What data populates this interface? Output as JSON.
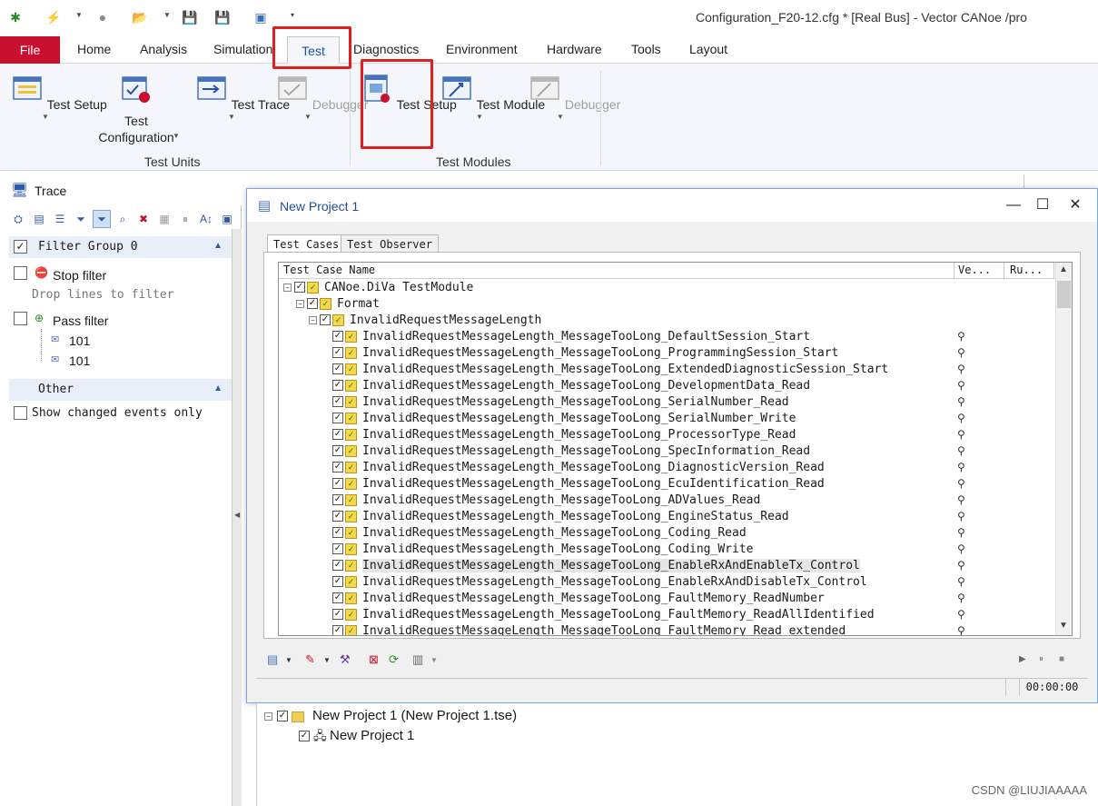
{
  "app": {
    "title": "Configuration_F20-12.cfg * [Real Bus] - Vector CANoe /pro",
    "watermark": "CSDN @LIUJIAAAAA"
  },
  "ribbon": {
    "tabs": [
      "File",
      "Home",
      "Analysis",
      "Simulation",
      "Test",
      "Diagnostics",
      "Environment",
      "Hardware",
      "Tools",
      "Layout"
    ],
    "active_tab": "Test",
    "groups": [
      {
        "label": "Test Units",
        "buttons": [
          {
            "label": "Test Setup",
            "enabled": true
          },
          {
            "label": "Test\nConfiguration",
            "enabled": true
          },
          {
            "label": "Test Trace",
            "enabled": true
          },
          {
            "label": "Debugger",
            "enabled": false
          }
        ]
      },
      {
        "label": "Test Modules",
        "buttons": [
          {
            "label": "Test Setup",
            "enabled": true
          },
          {
            "label": "Test Module",
            "enabled": true
          },
          {
            "label": "Debugger",
            "enabled": false
          }
        ]
      }
    ]
  },
  "trace": {
    "title": "Trace",
    "filter_group": "Filter Group 0",
    "stop_filter": "Stop filter",
    "drop_hint": "Drop lines to filter",
    "pass_filter": "Pass filter",
    "pass_items": [
      "101",
      "101"
    ],
    "other": "Other",
    "show_changed": "Show changed events only"
  },
  "dialog": {
    "title": "New Project 1",
    "tabs": [
      "Test Cases",
      "Test Observer"
    ],
    "columns": [
      "Test Case Name",
      "Ve...",
      "Ru..."
    ],
    "root": "CANoe.DiVa TestModule",
    "group": "Format",
    "subgroup": "InvalidRequestMessageLength",
    "cases": [
      "InvalidRequestMessageLength_MessageTooLong_DefaultSession_Start",
      "InvalidRequestMessageLength_MessageTooLong_ProgrammingSession_Start",
      "InvalidRequestMessageLength_MessageTooLong_ExtendedDiagnosticSession_Start",
      "InvalidRequestMessageLength_MessageTooLong_DevelopmentData_Read",
      "InvalidRequestMessageLength_MessageTooLong_SerialNumber_Read",
      "InvalidRequestMessageLength_MessageTooLong_SerialNumber_Write",
      "InvalidRequestMessageLength_MessageTooLong_ProcessorType_Read",
      "InvalidRequestMessageLength_MessageTooLong_SpecInformation_Read",
      "InvalidRequestMessageLength_MessageTooLong_DiagnosticVersion_Read",
      "InvalidRequestMessageLength_MessageTooLong_EcuIdentification_Read",
      "InvalidRequestMessageLength_MessageTooLong_ADValues_Read",
      "InvalidRequestMessageLength_MessageTooLong_EngineStatus_Read",
      "InvalidRequestMessageLength_MessageTooLong_Coding_Read",
      "InvalidRequestMessageLength_MessageTooLong_Coding_Write",
      "InvalidRequestMessageLength_MessageTooLong_EnableRxAndEnableTx_Control",
      "InvalidRequestMessageLength_MessageTooLong_EnableRxAndDisableTx_Control",
      "InvalidRequestMessageLength_MessageTooLong_FaultMemory_ReadNumber",
      "InvalidRequestMessageLength_MessageTooLong_FaultMemory_ReadAllIdentified",
      "InvalidRequestMessageLength_MessageTooLong_FaultMemory_Read_extended"
    ],
    "selected_case_index": 14,
    "status_time": "00:00:00"
  },
  "project": {
    "root": "New Project 1  (New Project 1.tse)",
    "child": "New Project 1"
  },
  "colors": {
    "file_tab": "#c8102e",
    "highlight": "#e0201e",
    "accent": "#1e4fa3"
  }
}
